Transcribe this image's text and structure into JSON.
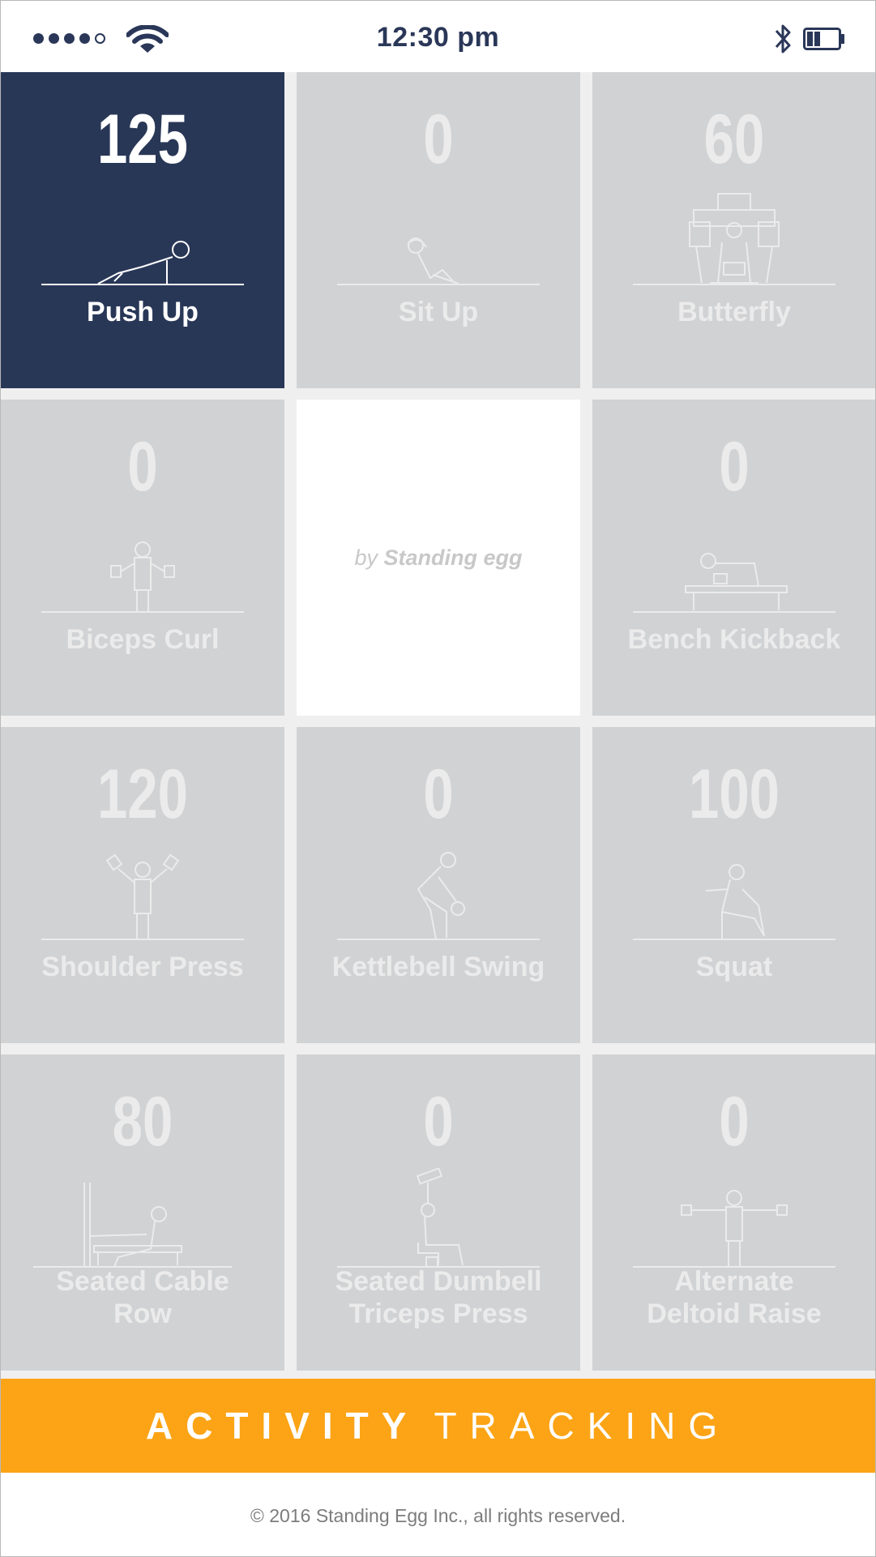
{
  "status_bar": {
    "time": "12:30 pm",
    "signal_bars_filled": 4,
    "signal_bars_total": 5,
    "icons": [
      "wifi-icon",
      "bluetooth-icon",
      "battery-icon"
    ],
    "battery_level": 0.4
  },
  "tiles": [
    {
      "count": "125",
      "label": "Push Up",
      "icon": "push-up-icon",
      "active": true
    },
    {
      "count": "0",
      "label": "Sit Up",
      "icon": "sit-up-icon",
      "active": false
    },
    {
      "count": "60",
      "label": "Butterfly",
      "icon": "butterfly-machine-icon",
      "active": false
    },
    {
      "count": "0",
      "label": "Biceps Curl",
      "icon": "biceps-curl-icon",
      "active": false
    },
    {
      "brand_by": "by",
      "brand_name": "Standing egg"
    },
    {
      "count": "0",
      "label": "Bench Kickback",
      "icon": "bench-kickback-icon",
      "active": false
    },
    {
      "count": "120",
      "label": "Shoulder Press",
      "icon": "shoulder-press-icon",
      "active": false
    },
    {
      "count": "0",
      "label": "Kettlebell Swing",
      "icon": "kettlebell-swing-icon",
      "active": false
    },
    {
      "count": "100",
      "label": "Squat",
      "icon": "squat-icon",
      "active": false
    },
    {
      "count": "80",
      "label_line1": "Seated Cable",
      "label_line2": "Row",
      "icon": "seated-cable-row-icon",
      "active": false
    },
    {
      "count": "0",
      "label_line1": "Seated Dumbell",
      "label_line2": "Triceps Press",
      "icon": "seated-triceps-press-icon",
      "active": false
    },
    {
      "count": "0",
      "label_line1": "Alternate",
      "label_line2": "Deltoid Raise",
      "icon": "deltoid-raise-icon",
      "active": false
    }
  ],
  "banner": {
    "word1": "ACTIVITY",
    "word2": "TRACKING"
  },
  "footer": {
    "copyright": "© 2016 Standing Egg Inc., all rights reserved."
  },
  "colors": {
    "navy": "#293757",
    "tile_gray": "#d1d2d4",
    "gutter": "#efefef",
    "orange": "#fca416",
    "muted_text": "#ebebeb"
  }
}
